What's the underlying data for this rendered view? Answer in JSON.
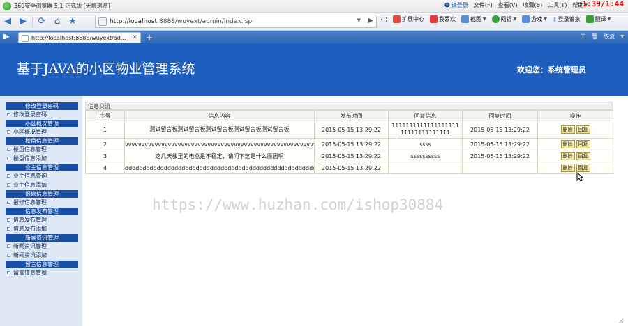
{
  "browser": {
    "title": "360安全浏览器 5.1 正式版 [无痕浏览]",
    "login_label": "请登录",
    "menus": [
      {
        "label": "文件(F)",
        "caret": false
      },
      {
        "label": "查看(V)",
        "caret": false
      },
      {
        "label": "收藏(B)",
        "caret": false
      },
      {
        "label": "工具(T)",
        "caret": false
      },
      {
        "label": "帮助",
        "caret": true
      }
    ],
    "clock": "1:39/1:44",
    "address": "http://localhost:8888/wuyext/admin/index.jsp",
    "address_host": "http://localhost",
    "address_rest": ":8888/wuyext/admin/index.jsp",
    "toolbar": [
      {
        "label": "扩展中心",
        "color": "#e74c3c"
      },
      {
        "label": "我喜欢",
        "color": "#e23b3b"
      },
      {
        "label": "截图",
        "color": "#5b8fd6"
      },
      {
        "label": "网银",
        "color": "#3a9e3a"
      },
      {
        "label": "游戏",
        "color": "#5b8fd6"
      },
      {
        "label": "登录管家",
        "color": "#2d6bc4"
      },
      {
        "label": "翻译",
        "color": "#3a9e3a"
      }
    ],
    "tab_label": "http://localhost:8888/wuyext/ad...",
    "tab_right_label": "恢复"
  },
  "page": {
    "site_title": "基于JAVA的小区物业管理系统",
    "welcome": "欢迎您：系统管理员",
    "panel_title": "信息交流",
    "columns": [
      "序号",
      "信息内容",
      "发布时间",
      "回复信息",
      "回复时间",
      "操作"
    ],
    "rows": [
      {
        "no": "1",
        "content": "测试留言板测试留言板测试留言板测试留言板测试留言板",
        "time": "2015-05-15 13:29:22",
        "reply": "111111111111111111111111111111111",
        "reply_time": "2015-05-15 13:29:22",
        "size": "tall"
      },
      {
        "no": "2",
        "content": "vvvvvvvvvvvvvvvvvvvvvvvvvvvvvvvvvvvvvvvvvvvvvvvvvvvvvvvvvvvvvvvvbbbbbbbbbb",
        "time": "2015-05-15 13:29:22",
        "reply": "ssss",
        "reply_time": "2015-05-15 13:29:22",
        "size": "short"
      },
      {
        "no": "3",
        "content": "这几天楼里的电总是不稳定，请问下这是什么原因啊",
        "time": "2015-05-15 13:29:22",
        "reply": "ssssssssss",
        "reply_time": "2015-05-15 13:29:22",
        "size": "short"
      },
      {
        "no": "4",
        "content": "dddddddddddddddddddddddddddddddddddddddddddddddddddddddd",
        "time": "2015-05-15 13:29:22",
        "reply": "",
        "reply_time": "",
        "size": "short"
      }
    ],
    "delete_label": "删除",
    "reply_label": "回复",
    "watermark": "https://www.huzhan.com/ishop30884"
  },
  "sidebar": {
    "groups": [
      {
        "title": "修改登录密码",
        "items": [
          "修改登录密码"
        ]
      },
      {
        "title": "小区概况管理",
        "items": [
          "小区概况管理"
        ]
      },
      {
        "title": "楼盘信息管理",
        "items": [
          "楼盘信息管理",
          "楼盘信息添加"
        ]
      },
      {
        "title": "业主信息管理",
        "items": [
          "业主信息查询",
          "业主信息添加"
        ]
      },
      {
        "title": "报修信息管理",
        "items": [
          "报修信息管理"
        ]
      },
      {
        "title": "信息发布管理",
        "items": [
          "信息发布管理",
          "信息发布添加"
        ]
      },
      {
        "title": "新闻资讯管理",
        "items": [
          "新闻资讯管理",
          "新闻资讯添加"
        ]
      },
      {
        "title": "留言信息管理",
        "items": [
          "留言信息管理"
        ]
      }
    ]
  }
}
